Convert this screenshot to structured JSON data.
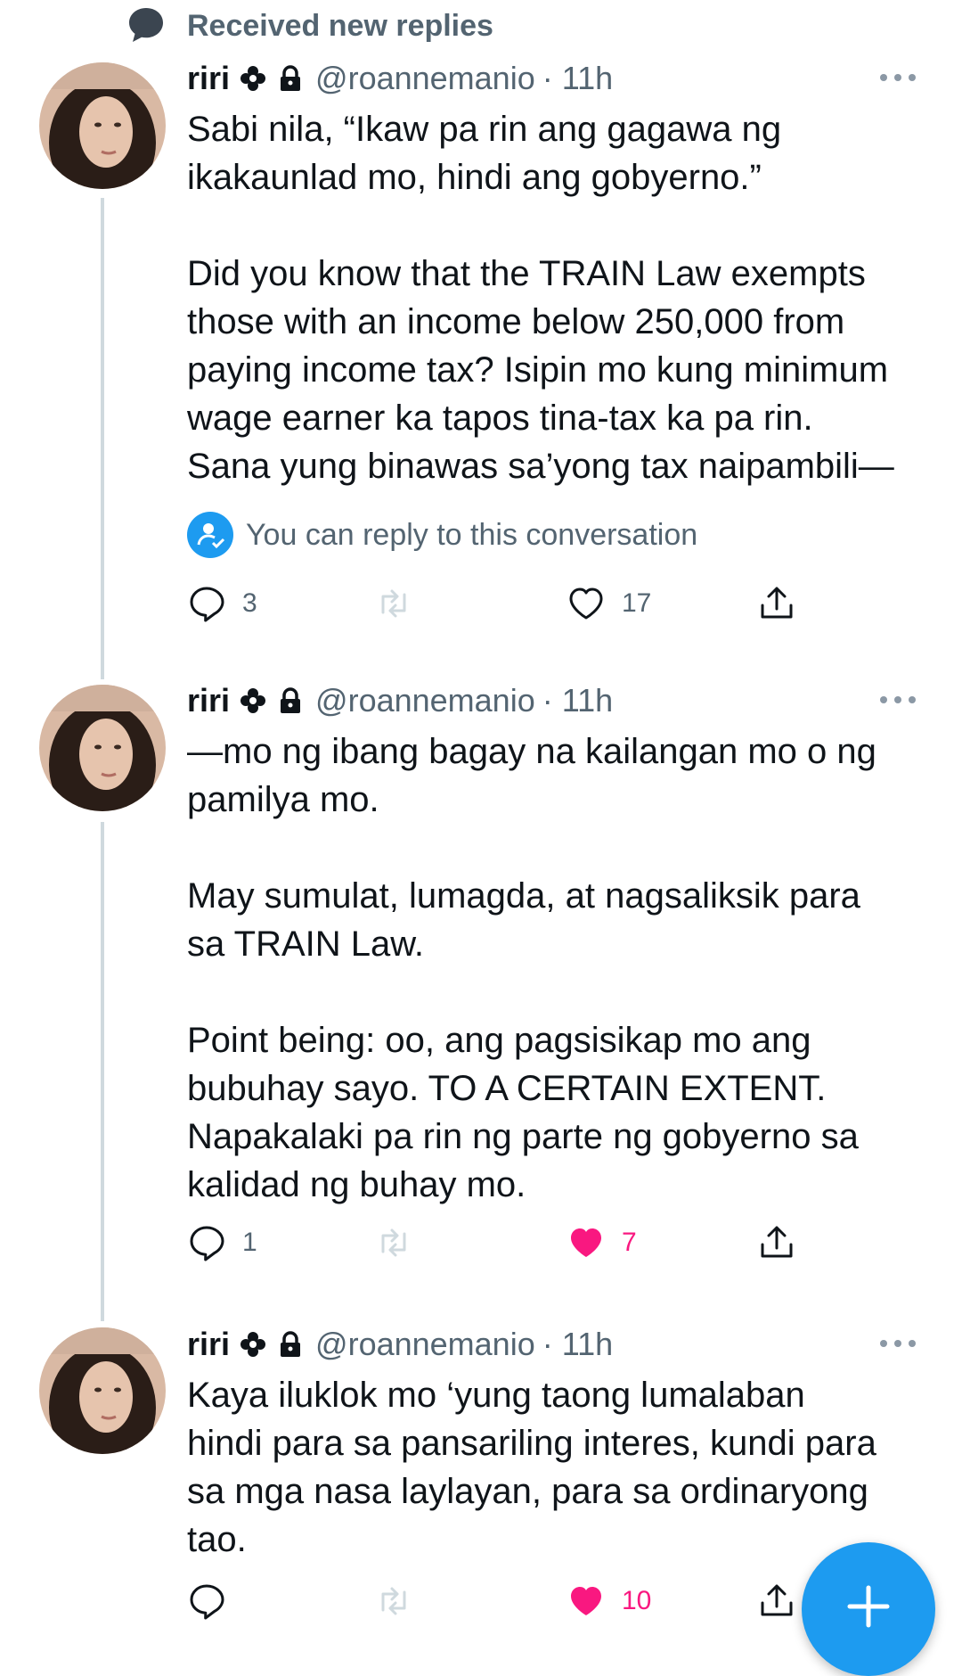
{
  "banner": {
    "text": "Received new replies",
    "icon": "speech-bubble-icon"
  },
  "tweets": [
    {
      "name": "riri",
      "badges": [
        "flower-icon",
        "lock-icon"
      ],
      "handle": "@roannemanio",
      "time": "· 11h",
      "paragraphs": [
        "Sabi nila, “Ikaw pa rin ang gagawa ng\nikakaunlad mo, hindi ang gobyerno.”",
        "Did you know that the TRAIN Law exempts\nthose with an income below 250,000 from\npaying income tax? Isipin mo kung minimum\nwage earner ka tapos tina-tax ka pa rin.\nSana yung binawas sa’yong tax naipambili—"
      ],
      "reply_note": "You can reply to this conversation",
      "reply_count": "3",
      "retweet_count": "",
      "like_count": "17",
      "liked": false
    },
    {
      "name": "riri",
      "badges": [
        "flower-icon",
        "lock-icon"
      ],
      "handle": "@roannemanio",
      "time": "· 11h",
      "paragraphs": [
        "—mo ng ibang bagay na kailangan mo o ng\npamilya mo.",
        "May sumulat, lumagda, at nagsaliksik para\nsa TRAIN Law.",
        "Point being: oo, ang pagsisikap mo ang\nbubuhay sayo. TO A CERTAIN EXTENT.\nNapakalaki pa rin ng parte ng gobyerno sa\nkalidad ng buhay mo."
      ],
      "reply_count": "1",
      "retweet_count": "",
      "like_count": "7",
      "liked": true
    },
    {
      "name": "riri",
      "badges": [
        "flower-icon",
        "lock-icon"
      ],
      "handle": "@roannemanio",
      "time": "· 11h",
      "paragraphs": [
        "Kaya iluklok mo ‘yung  taong lumalaban\nhindi para sa pansariling interes, kundi para\nsa mga nasa laylayan, para sa ordinaryong\ntao."
      ],
      "reply_count": "",
      "retweet_count": "",
      "like_count": "10",
      "liked": true
    }
  ],
  "fab": {
    "icon": "plus-icon"
  },
  "colors": {
    "accent": "#1d9bf0",
    "like": "#f91880",
    "secondary_text": "#536471",
    "thread_line": "#cfd9de"
  }
}
